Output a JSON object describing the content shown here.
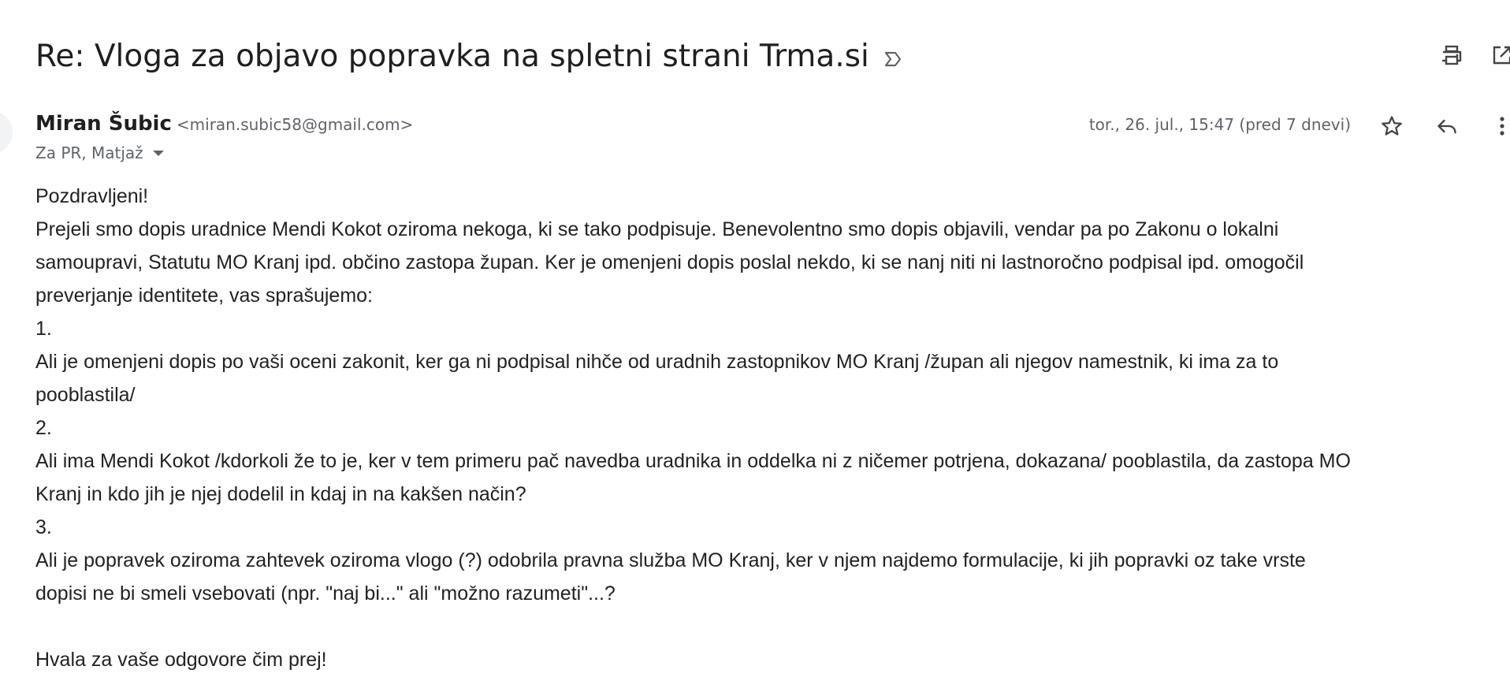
{
  "email": {
    "subject": "Re: Vloga za objavo popravka na spletni strani Trma.si",
    "sender_name": "Miran Šubic",
    "sender_email": "<miran.subic58@gmail.com>",
    "recipients": "Za PR, Matjaž",
    "date": "tor., 26. jul., 15:47 (pred 7 dnevi)",
    "body_lines": [
      "Pozdravljeni!",
      "Prejeli smo dopis uradnice Mendi Kokot oziroma nekoga, ki se tako podpisuje. Benevolentno smo dopis objavili, vendar pa po Zakonu o lokalni",
      "samoupravi, Statutu MO Kranj ipd. občino zastopa župan. Ker je omenjeni dopis poslal nekdo, ki se nanj niti ni lastnoročno podpisal ipd. omogočil",
      "preverjanje identitete, vas sprašujemo:",
      "1.",
      "Ali je omenjeni dopis po vaši oceni zakonit, ker ga ni podpisal nihče od uradnih zastopnikov MO Kranj /župan ali njegov namestnik, ki ima za to",
      "pooblastila/",
      "2.",
      "Ali ima Mendi Kokot /kdorkoli že to je, ker v tem primeru pač navedba uradnika in oddelka ni z ničemer potrjena, dokazana/ pooblastila, da zastopa MO",
      "Kranj in kdo jih je njej dodelil in kdaj in na kakšen način?",
      "3.",
      "Ali je popravek oziroma zahtevek oziroma vlogo (?) odobrila pravna služba MO Kranj, ker v njem najdemo formulacije, ki jih popravki oz take vrste",
      "dopisi ne bi smeli vsebovati (npr. \"naj bi...\" ali \"možno razumeti\"...?",
      "",
      "Hvala za vaše odgovore čim prej!"
    ]
  },
  "icons": {
    "important_marker": "importance-marker-icon",
    "print": "print-icon",
    "open_new_window": "open-in-new-window-icon",
    "star": "star-icon",
    "reply": "reply-icon",
    "more": "more-vert-icon"
  }
}
